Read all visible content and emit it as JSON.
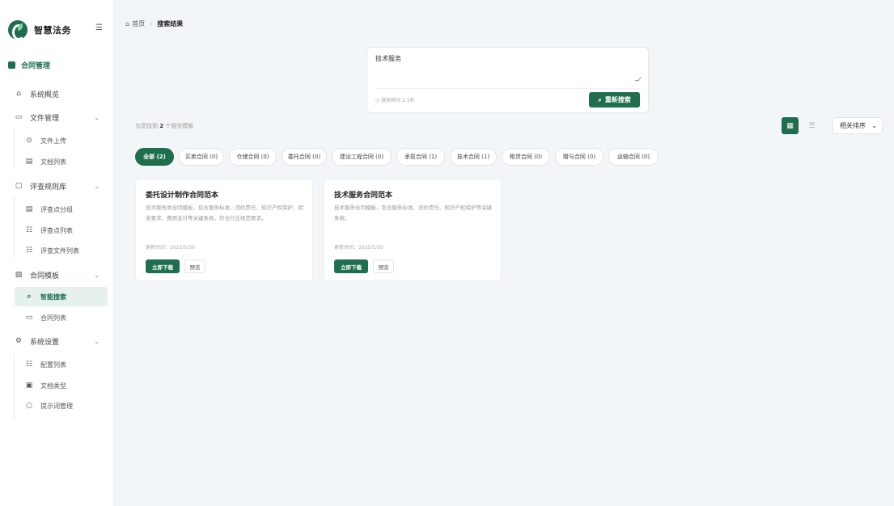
{
  "app": {
    "title": "智慧法务"
  },
  "sidebar": {
    "section_label": "合同管理",
    "items": [
      {
        "label": "系统概览",
        "icon": "⌂"
      },
      {
        "label": "文件管理",
        "icon": "▭"
      },
      {
        "label": "文件上传",
        "icon": "⊙"
      },
      {
        "label": "文档列表",
        "icon": "▤"
      },
      {
        "label": "评查规则库",
        "icon": "▢"
      },
      {
        "label": "评查点分组",
        "icon": "▤"
      },
      {
        "label": "评查点列表",
        "icon": "☷"
      },
      {
        "label": "评查文件列表",
        "icon": "☷"
      },
      {
        "label": "合同模板",
        "icon": "▧"
      },
      {
        "label": "智能搜索",
        "icon": "⌕"
      },
      {
        "label": "合同列表",
        "icon": "▭"
      },
      {
        "label": "系统设置",
        "icon": "⚙"
      },
      {
        "label": "配置列表",
        "icon": "☷"
      },
      {
        "label": "文档类型",
        "icon": "▣"
      },
      {
        "label": "提示词管理",
        "icon": "○"
      }
    ]
  },
  "breadcrumb": {
    "home": "首页",
    "current": "搜索结果"
  },
  "search": {
    "query": "技术服务",
    "meta": "搜索耗时 2.1秒",
    "button_label": "重新搜索"
  },
  "results": {
    "count_prefix": "为您找到",
    "count": "2",
    "count_suffix": "个相关模板"
  },
  "sort": {
    "selected": "相关排序"
  },
  "categories": [
    "全部 (2)",
    "买卖合同 (0)",
    "仓储合同 (0)",
    "委托合同 (0)",
    "建设工程合同 (0)",
    "承揽合同 (1)",
    "技术合同 (1)",
    "租赁合同 (0)",
    "赠与合同 (0)",
    "运输合同 (0)"
  ],
  "cards": [
    {
      "title": "委托设计制作合同范本",
      "desc": "技术服务类合同模板，包含服务标准、违约责任、知识产权保护、验收要求、费用支付等关键条款，符合行业规范要求。",
      "date": "更新时间：2025/5/30",
      "download": "立即下载",
      "preview": "预览"
    },
    {
      "title": "技术服务合同范本",
      "desc": "技术服务合同模板，包含服务标准、违约责任、知识产权保护等关键条款。",
      "date": "更新时间：2025/5/30",
      "download": "立即下载",
      "preview": "预览"
    }
  ],
  "colors": {
    "accent": "#1f6e4e"
  }
}
